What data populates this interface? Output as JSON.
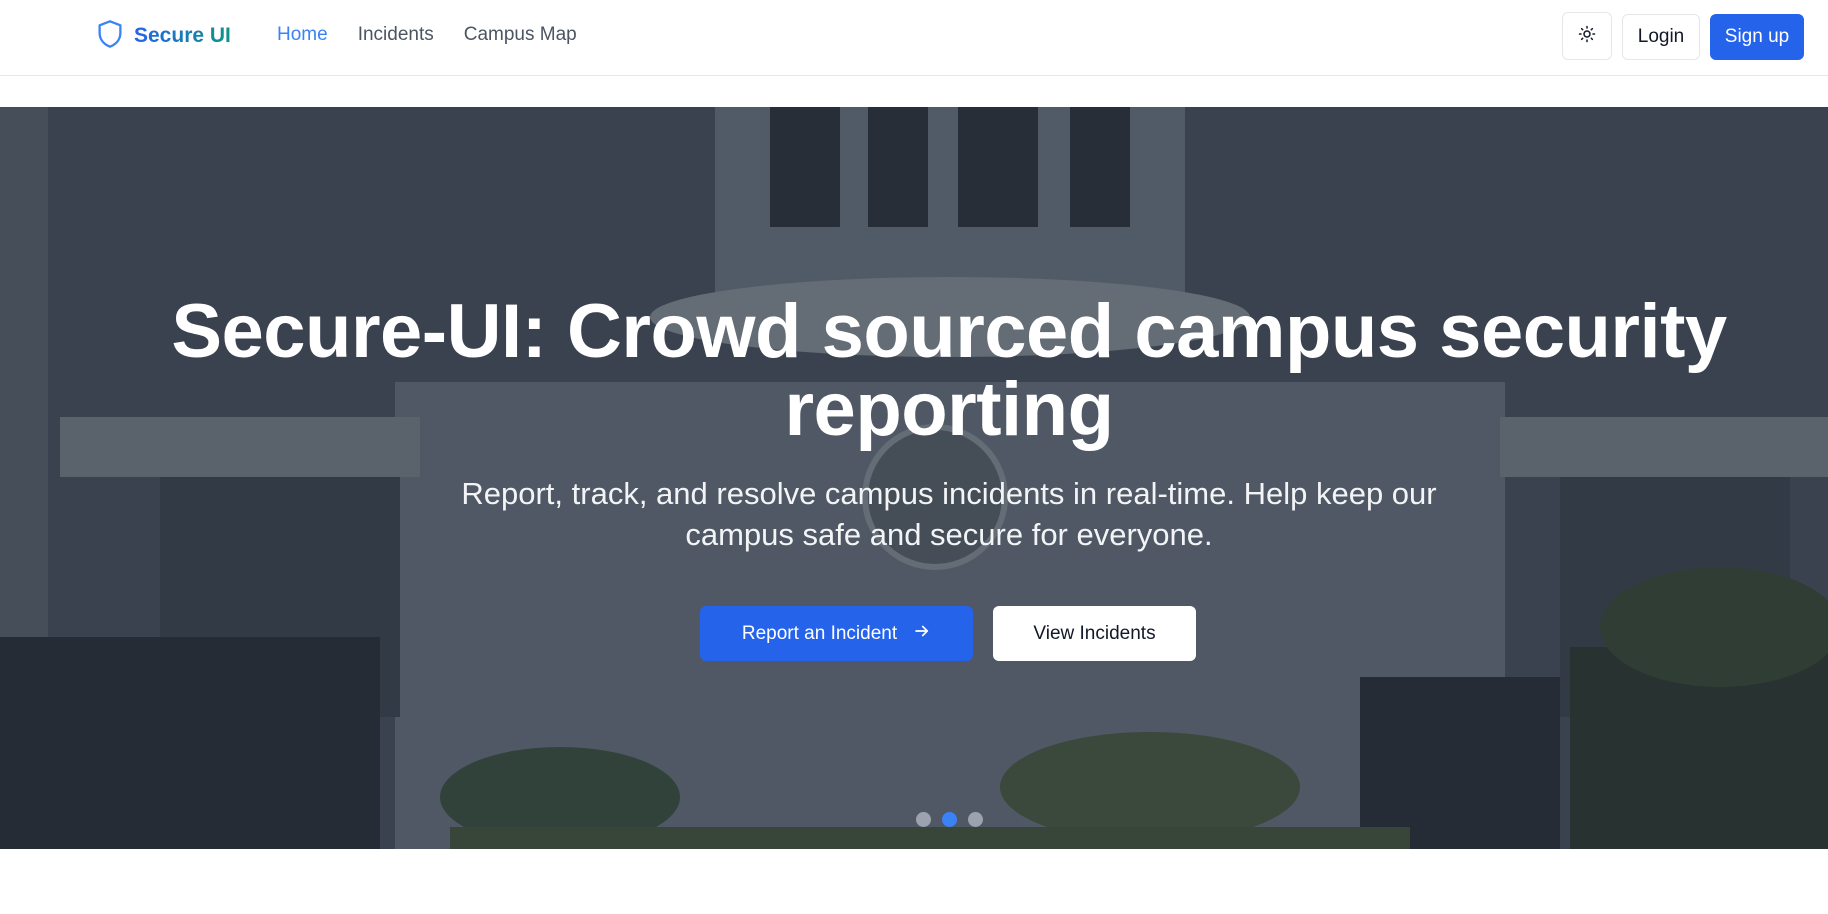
{
  "app": {
    "brand_name": "Secure UI",
    "brand_icon": "shield-icon",
    "accent_color": "#2563eb"
  },
  "nav": {
    "links": [
      {
        "label": "Home",
        "active": true
      },
      {
        "label": "Incidents",
        "active": false
      },
      {
        "label": "Campus Map",
        "active": false
      }
    ]
  },
  "header_actions": {
    "theme_toggle_icon": "sun-icon",
    "login_label": "Login",
    "signup_label": "Sign up"
  },
  "hero": {
    "title": "Secure-UI: Crowd sourced campus security reporting",
    "subtitle": "Report, track, and resolve campus incidents in real-time. Help keep our campus safe and secure for everyone.",
    "primary_cta": "Report an Incident",
    "primary_cta_icon": "arrow-right-icon",
    "secondary_cta": "View Incidents",
    "carousel": {
      "slide_count": 3,
      "active_index": 1
    }
  }
}
